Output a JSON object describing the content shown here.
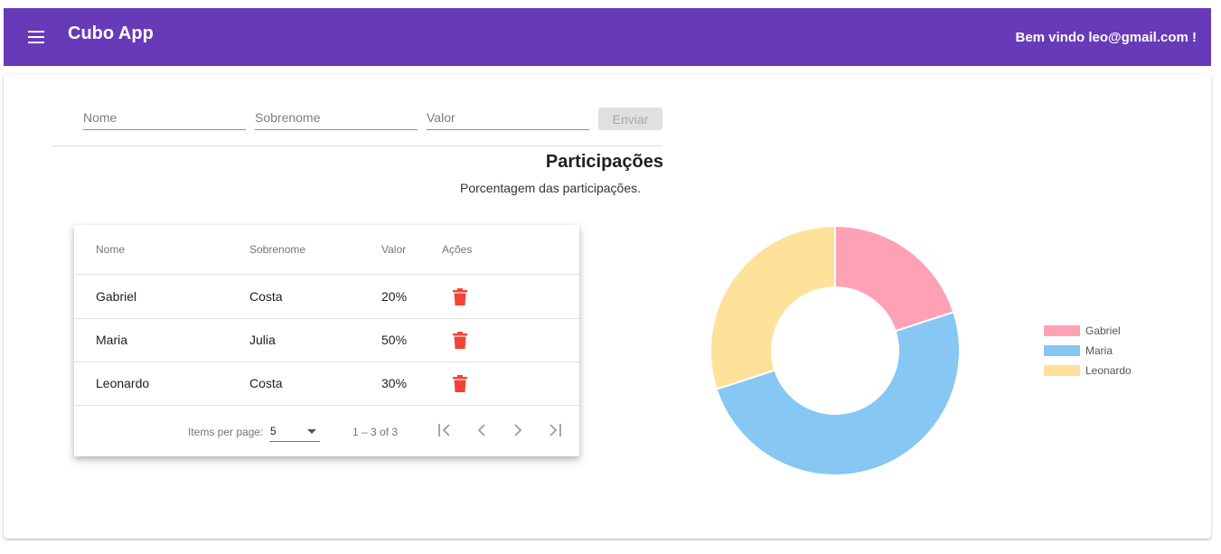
{
  "toolbar": {
    "title": "Cubo App",
    "welcome": "Bem vindo leo@gmail.com !",
    "menu_icon": "menu-icon"
  },
  "form": {
    "nome_placeholder": "Nome",
    "sobrenome_placeholder": "Sobrenome",
    "valor_placeholder": "Valor",
    "nome_value": "",
    "sobrenome_value": "",
    "valor_value": "",
    "submit_label": "Enviar"
  },
  "section": {
    "title": "Participações",
    "subtitle": "Porcentagem das participações."
  },
  "table": {
    "headers": [
      "Nome",
      "Sobrenome",
      "Valor",
      "Ações"
    ],
    "rows": [
      {
        "nome": "Gabriel",
        "sobrenome": "Costa",
        "valor": "20%",
        "action_icon": "trash-icon"
      },
      {
        "nome": "Maria",
        "sobrenome": "Julia",
        "valor": "50%",
        "action_icon": "trash-icon"
      },
      {
        "nome": "Leonardo",
        "sobrenome": "Costa",
        "valor": "30%",
        "action_icon": "trash-icon"
      }
    ],
    "paginator": {
      "items_per_page_label": "Items per page:",
      "items_per_page_value": "5",
      "range_label": "1 – 3 of 3",
      "icons": [
        "first-page-icon",
        "previous-page-icon",
        "next-page-icon",
        "last-page-icon"
      ]
    }
  },
  "colors": {
    "primary": "#673ab7",
    "delete": "#f44336",
    "gabriel": "#ffa1b5",
    "maria": "#86c7f3",
    "leonardo": "#ffe29a"
  },
  "chart_data": {
    "type": "pie",
    "variant": "doughnut",
    "title": "",
    "legend_position": "right",
    "categories": [
      "Gabriel",
      "Maria",
      "Leonardo"
    ],
    "values": [
      20,
      50,
      30
    ],
    "colors": [
      "#ffa1b5",
      "#86c7f3",
      "#ffe29a"
    ]
  }
}
